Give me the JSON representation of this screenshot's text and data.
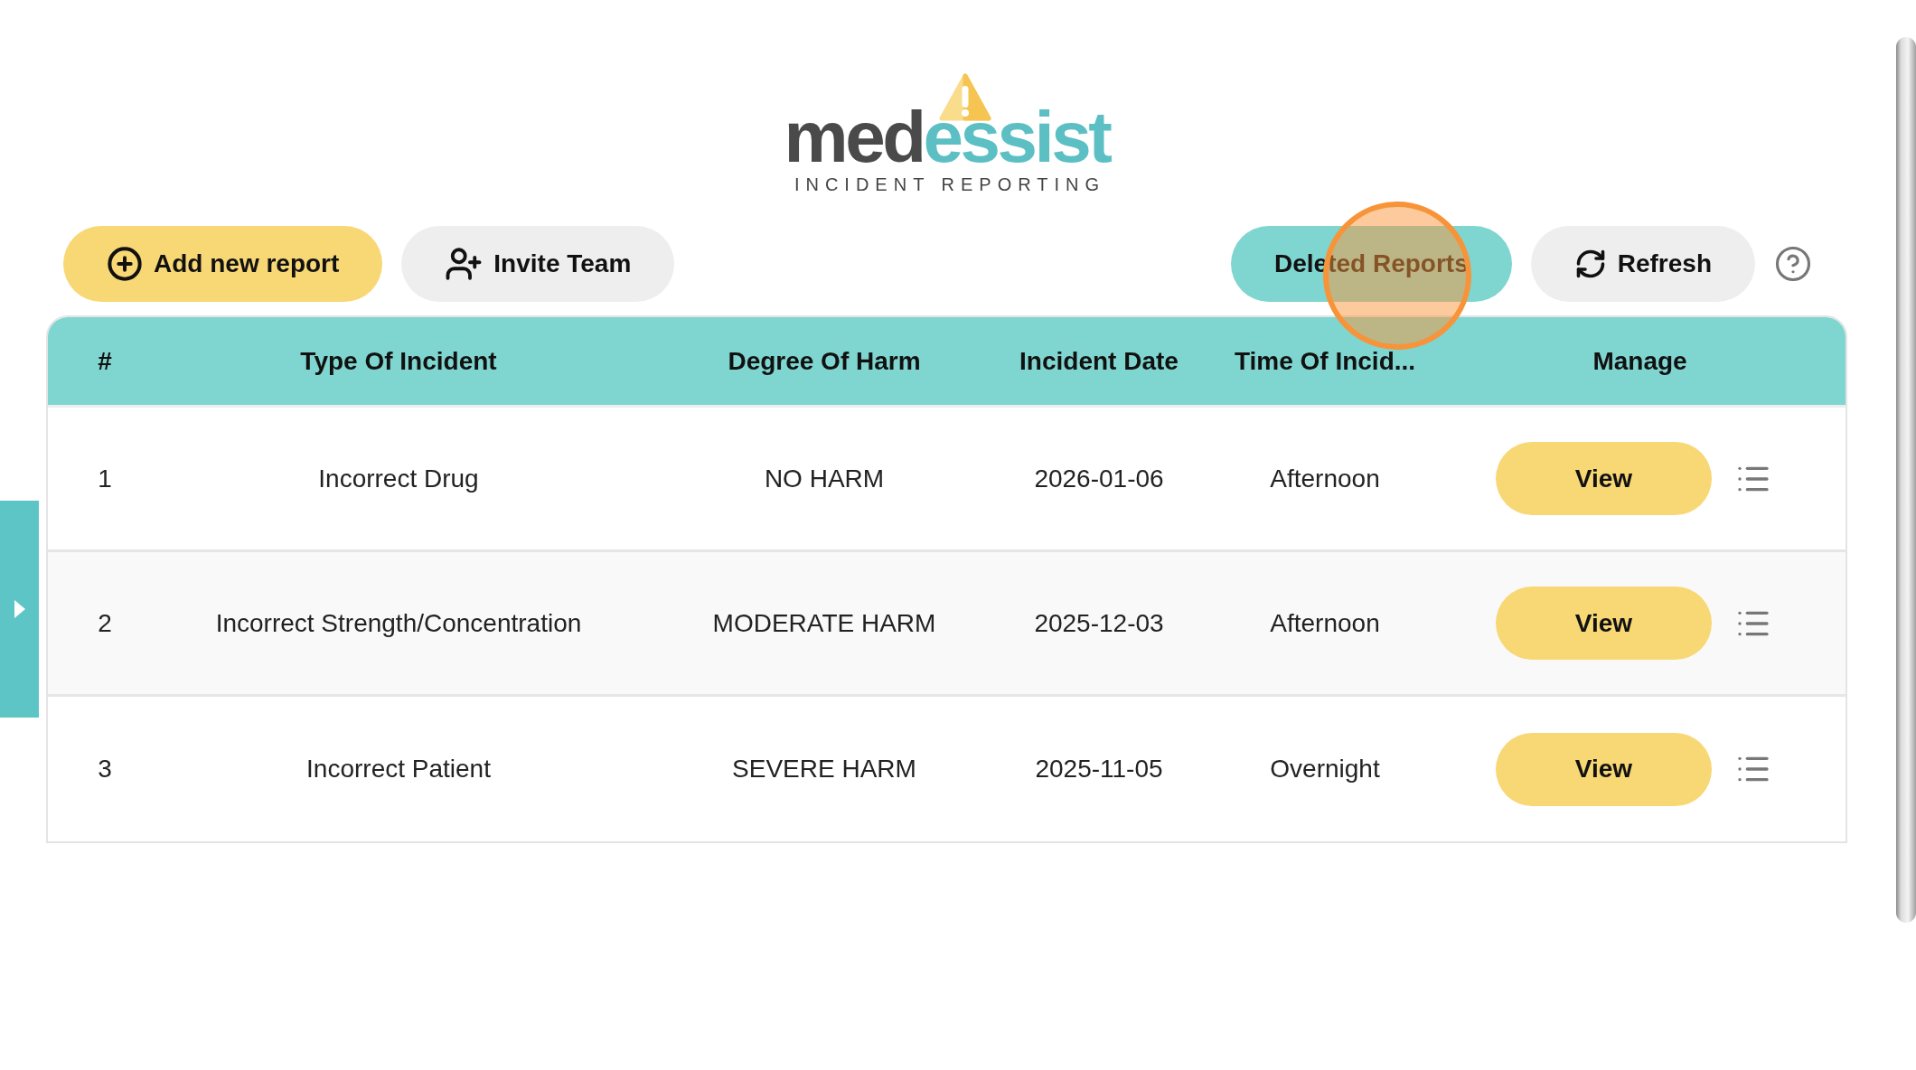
{
  "logo": {
    "wordmark_dark": "med",
    "wordmark_accent": "essist",
    "tagline": "INCIDENT REPORTING"
  },
  "toolbar": {
    "add_report": {
      "label": "Add new report"
    },
    "invite_team": {
      "label": "Invite Team"
    },
    "deleted_reports": {
      "label": "Deleted Reports",
      "clicked": true
    },
    "refresh": {
      "label": "Refresh"
    }
  },
  "table": {
    "columns": [
      "#",
      "Type Of Incident",
      "Degree Of Harm",
      "Incident Date",
      "Time Of Incid...",
      "Manage"
    ],
    "rows": [
      {
        "cells": [
          "1",
          "Incorrect Drug",
          "NO HARM",
          "2026-01-06",
          "Afternoon"
        ],
        "action": "View"
      },
      {
        "cells": [
          "2",
          "Incorrect Strength/Concentration",
          "MODERATE HARM",
          "2025-12-03",
          "Afternoon"
        ],
        "action": "View"
      },
      {
        "cells": [
          "3",
          "Incorrect Patient",
          "SEVERE HARM",
          "2025-11-05",
          "Overnight"
        ],
        "action": "View"
      }
    ]
  }
}
